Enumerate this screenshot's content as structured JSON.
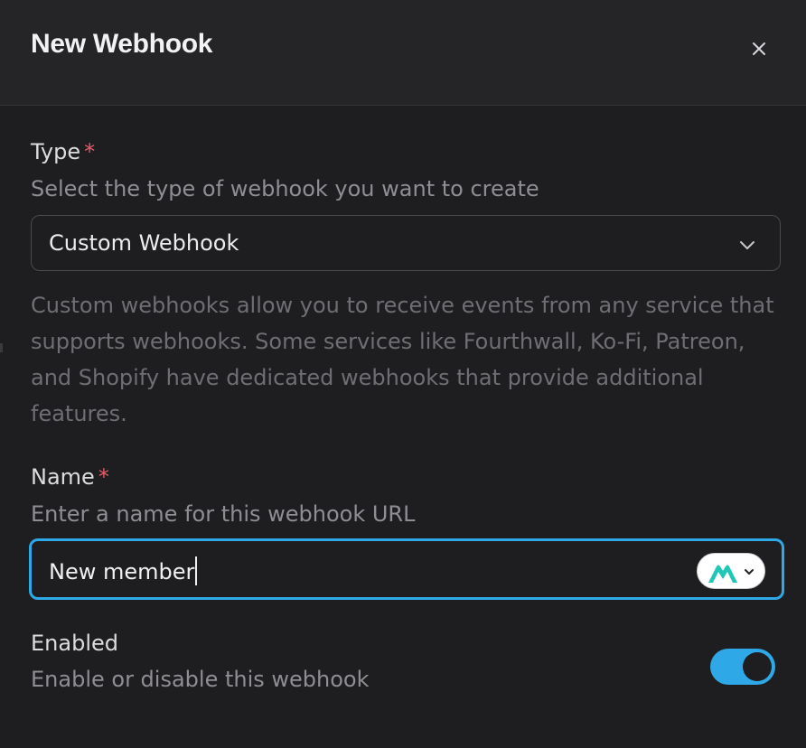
{
  "dialog": {
    "title": "New Webhook",
    "close_icon": "close-icon"
  },
  "type_field": {
    "label": "Type",
    "required_mark": "*",
    "description": "Select the type of webhook you want to create",
    "selected_value": "Custom Webhook",
    "chevron_icon": "chevron-down-icon",
    "helper_text": "Custom webhooks allow you to receive events from any service that supports webhooks. Some services like Fourthwall, Ko-Fi, Patreon, and Shopify have dedicated webhooks that provide additional features."
  },
  "name_field": {
    "label": "Name",
    "required_mark": "*",
    "description": "Enter a name for this webhook URL",
    "value": "New member",
    "emoji_icon": "mountain-logo-icon",
    "dropdown_icon": "chevron-down-icon"
  },
  "enabled_field": {
    "label": "Enabled",
    "description": "Enable or disable this webhook",
    "toggle_on": true
  },
  "colors": {
    "accent": "#2ea8e6",
    "required": "#e35d6a",
    "background": "#1e1e20",
    "header_background": "#252528",
    "logo": "#1fc7b6"
  }
}
